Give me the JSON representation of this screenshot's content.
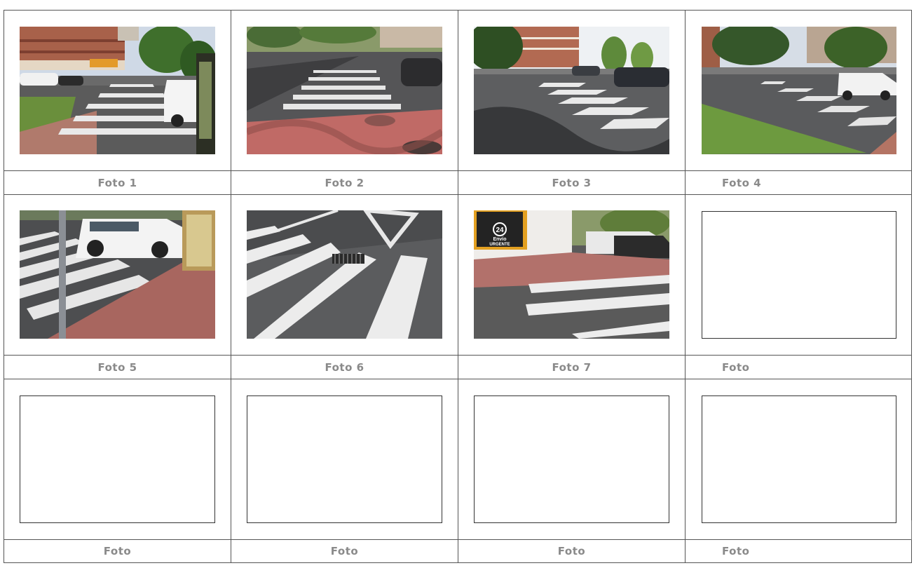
{
  "captions": {
    "c1": "Foto 1",
    "c2": "Foto 2",
    "c3": "Foto 3",
    "c4": "Foto 4",
    "c5": "Foto 5",
    "c6": "Foto 6",
    "c7": "Foto 7",
    "c8": "Foto",
    "c9": "Foto",
    "c10": "Foto",
    "c11": "Foto",
    "c12": "Foto"
  },
  "shop_sign": {
    "line1": "24",
    "line2": "Envío",
    "line3": "URGENTE"
  },
  "colors": {
    "border": "#555555",
    "caption_text": "#8a8a8a",
    "asphalt": "#4a4a4c",
    "paving_red": "#b0706a",
    "grass": "#6f9a3e"
  }
}
